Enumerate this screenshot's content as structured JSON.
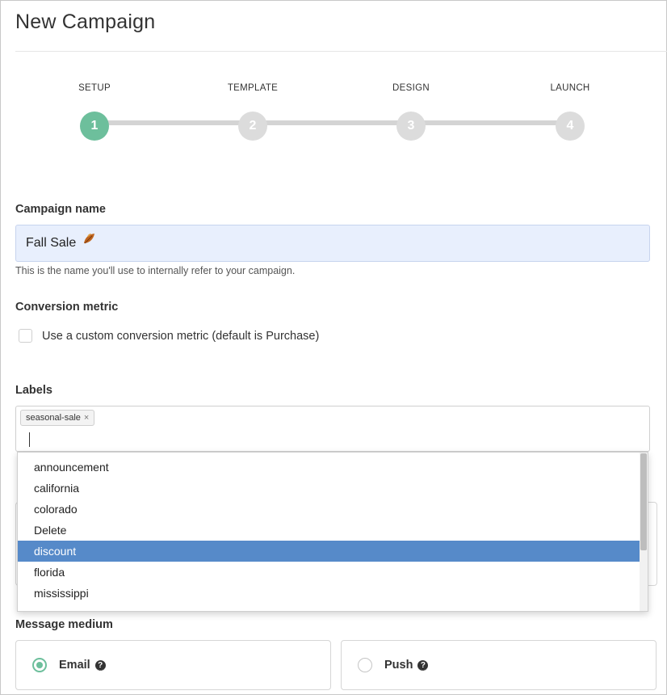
{
  "page": {
    "title": "New Campaign"
  },
  "stepper": {
    "steps": [
      {
        "label": "SETUP",
        "number": "1",
        "active": true
      },
      {
        "label": "TEMPLATE",
        "number": "2",
        "active": false
      },
      {
        "label": "DESIGN",
        "number": "3",
        "active": false
      },
      {
        "label": "LAUNCH",
        "number": "4",
        "active": false
      }
    ]
  },
  "campaign_name": {
    "label": "Campaign name",
    "value": "Fall Sale",
    "icon": "fallen-leaf-icon",
    "help": "This is the name you'll use to internally refer to your campaign."
  },
  "conversion": {
    "label": "Conversion metric",
    "checkbox_label": "Use a custom conversion metric (default is Purchase)",
    "checked": false
  },
  "labels": {
    "label": "Labels",
    "tags": [
      {
        "text": "seasonal-sale",
        "remove": "×"
      }
    ],
    "options": [
      "announcement",
      "california",
      "colorado",
      "Delete",
      "discount",
      "florida",
      "mississippi"
    ],
    "highlighted": "discount"
  },
  "message_medium": {
    "label": "Message medium",
    "options": [
      {
        "label": "Email",
        "selected": true,
        "help": "?"
      },
      {
        "label": "Push",
        "selected": false,
        "help": "?"
      }
    ]
  },
  "colors": {
    "accent": "#6dbf9c",
    "highlight": "#568ac9",
    "input_bg": "#e8effd"
  }
}
